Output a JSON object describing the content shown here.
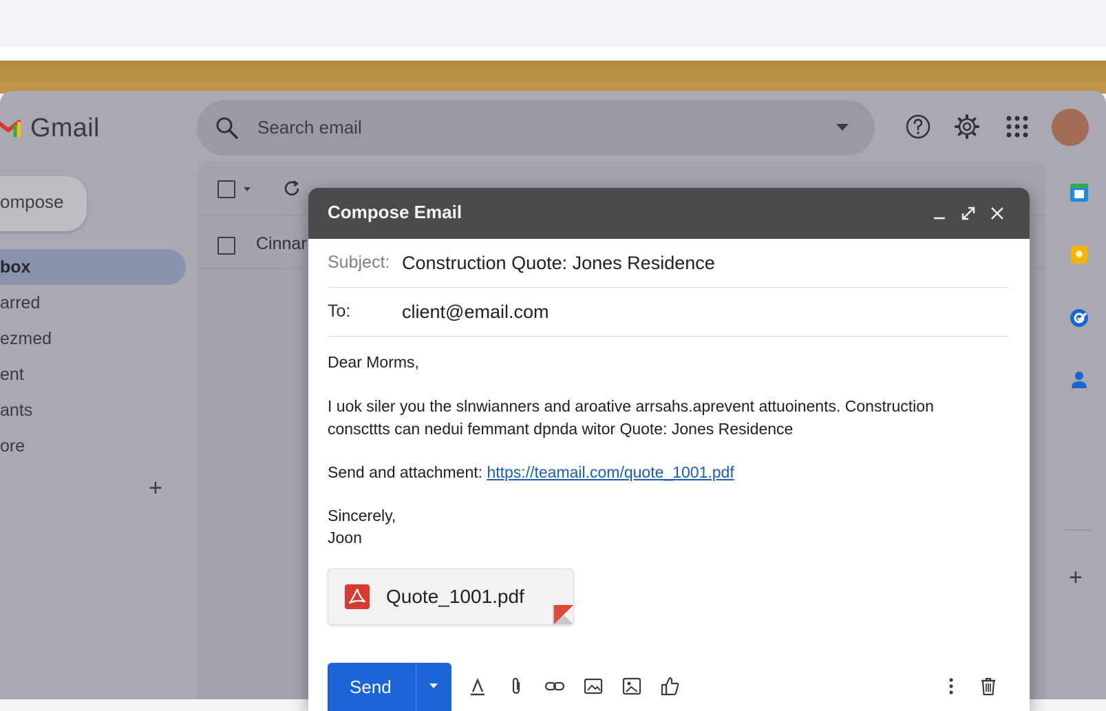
{
  "app": {
    "name": "Gmail"
  },
  "search": {
    "placeholder": "Search email"
  },
  "sidebar": {
    "compose_label": "ompose",
    "items": [
      {
        "label": "box",
        "active": true
      },
      {
        "label": "arred"
      },
      {
        "label": "ezmed"
      },
      {
        "label": "ent"
      },
      {
        "label": "ants"
      },
      {
        "label": "ore"
      }
    ],
    "add_label": "+"
  },
  "list": {
    "rows": [
      {
        "sender": "Cinnar"
      }
    ]
  },
  "compose": {
    "title": "Compose Email",
    "subject_label": "Subject:",
    "subject_value": "Construction Quote: Jones Residence",
    "to_label": "To:",
    "to_value": "client@email.com",
    "greeting": "Dear Morms,",
    "paragraph": "I uok siler you the slnwianners and aroative arrsahs.aprevent attuoinents. Construction conscttts can nedui femmant dpnda witor Quote: Jones Residence",
    "attachment_prefix": "Send and attachment: ",
    "attachment_link": "https://teamail.com/quote_1001.pdf",
    "signoff": "Sincerely,",
    "signature": "Joon",
    "attachment_file": "Quote_1001.pdf",
    "send_label": "Send"
  },
  "rail": {
    "add_label": "+"
  },
  "colors": {
    "accent": "#1a64d6",
    "compose_header": "#4b4b4d",
    "link": "#1a5fb4",
    "pdf_red": "#d93a2f",
    "tan_band": "#bf9449",
    "avatar": "#a26c57"
  },
  "icons": [
    "gmail-logo-icon",
    "search-icon",
    "dropdown-caret-icon",
    "help-icon",
    "settings-gear-icon",
    "apps-grid-icon",
    "refresh-icon",
    "minimize-icon",
    "expand-icon",
    "close-icon",
    "pdf-icon",
    "text-format-icon",
    "paperclip-icon",
    "link-icon",
    "image-icon",
    "photo-icon",
    "thumbs-up-icon",
    "more-vert-icon",
    "trash-icon",
    "calendar-icon",
    "keep-icon",
    "tasks-icon",
    "contacts-icon"
  ]
}
